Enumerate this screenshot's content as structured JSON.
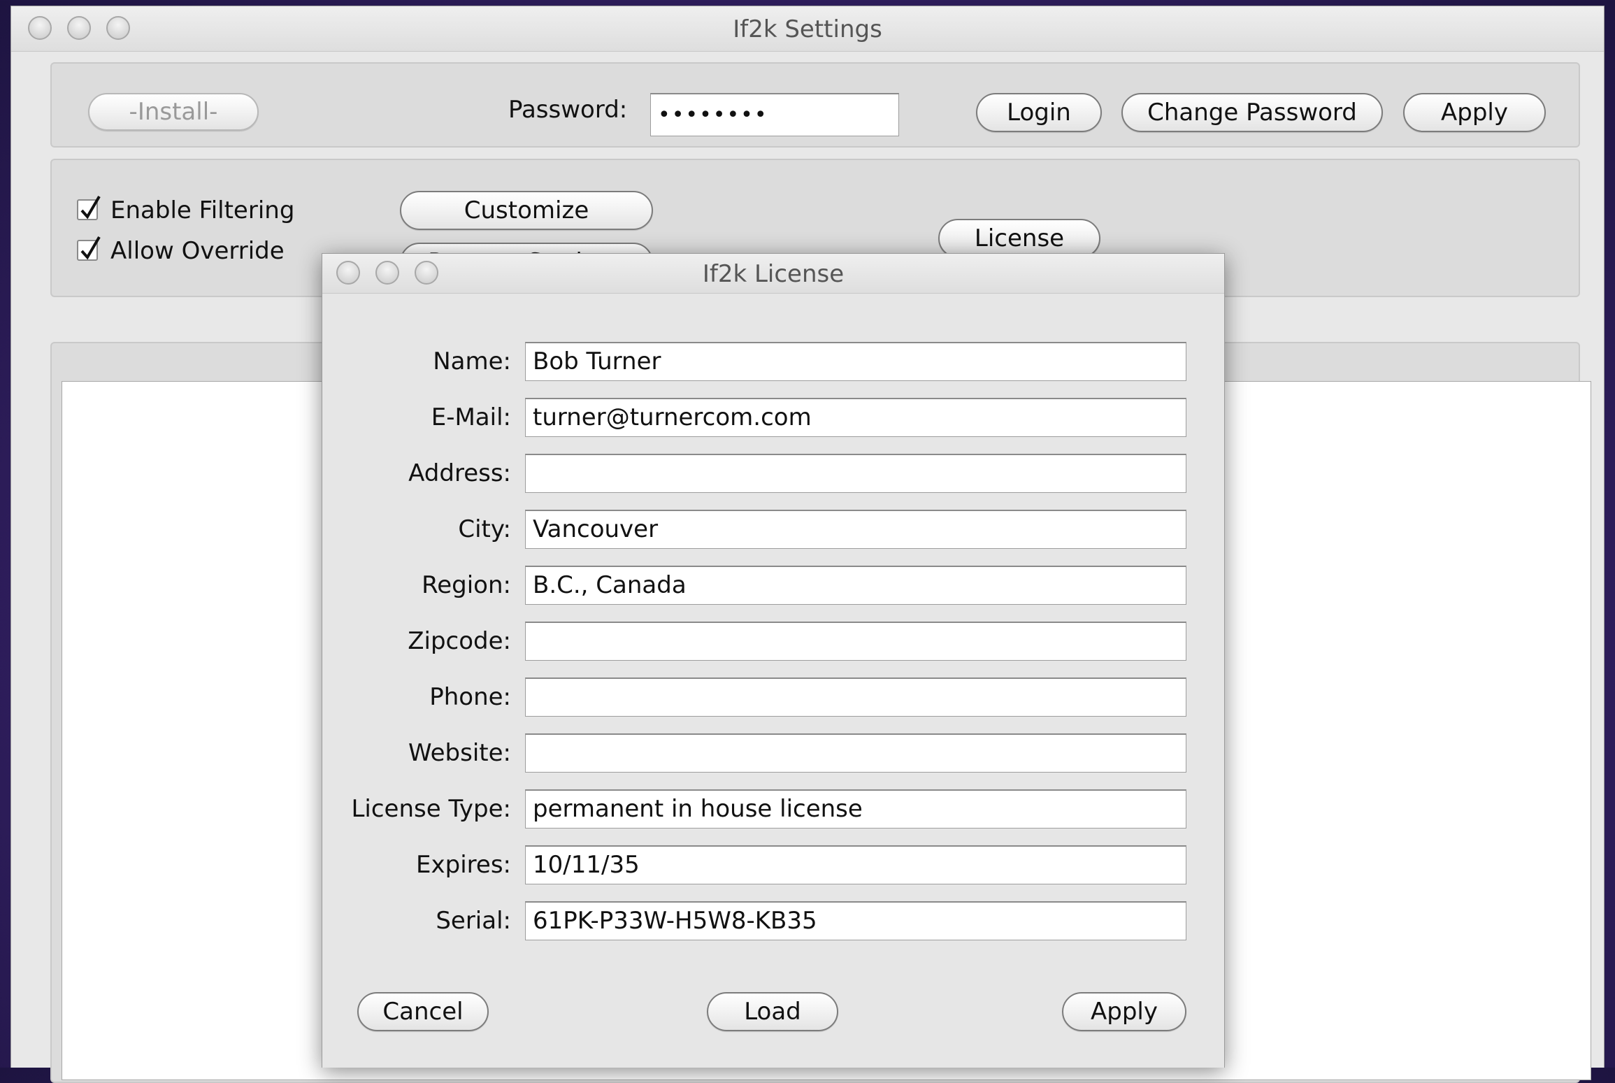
{
  "settings_window": {
    "title": "If2k Settings",
    "install_label": "-Install-",
    "password_label": "Password:",
    "password_value": "••••••••",
    "login_label": "Login",
    "change_password_label": "Change Password",
    "apply_label": "Apply",
    "enable_filtering_label": "Enable Filtering",
    "enable_filtering_checked": true,
    "allow_override_label": "Allow Override",
    "allow_override_checked": true,
    "customize_label": "Customize",
    "remote_settings_label": "Remote Settings",
    "license_label": "License"
  },
  "license_dialog": {
    "title": "If2k License",
    "fields": {
      "name": {
        "label": "Name:",
        "value": "Bob Turner"
      },
      "email": {
        "label": "E-Mail:",
        "value": "turner@turnercom.com"
      },
      "address": {
        "label": "Address:",
        "value": ""
      },
      "city": {
        "label": "City:",
        "value": "Vancouver"
      },
      "region": {
        "label": "Region:",
        "value": "B.C., Canada"
      },
      "zipcode": {
        "label": "Zipcode:",
        "value": ""
      },
      "phone": {
        "label": "Phone:",
        "value": ""
      },
      "website": {
        "label": "Website:",
        "value": ""
      },
      "license_type": {
        "label": "License Type:",
        "value": "permanent in house license"
      },
      "expires": {
        "label": "Expires:",
        "value": "10/11/35"
      },
      "serial": {
        "label": "Serial:",
        "value": "61PK-P33W-H5W8-KB35"
      }
    },
    "cancel_label": "Cancel",
    "load_label": "Load",
    "apply_label": "Apply"
  }
}
